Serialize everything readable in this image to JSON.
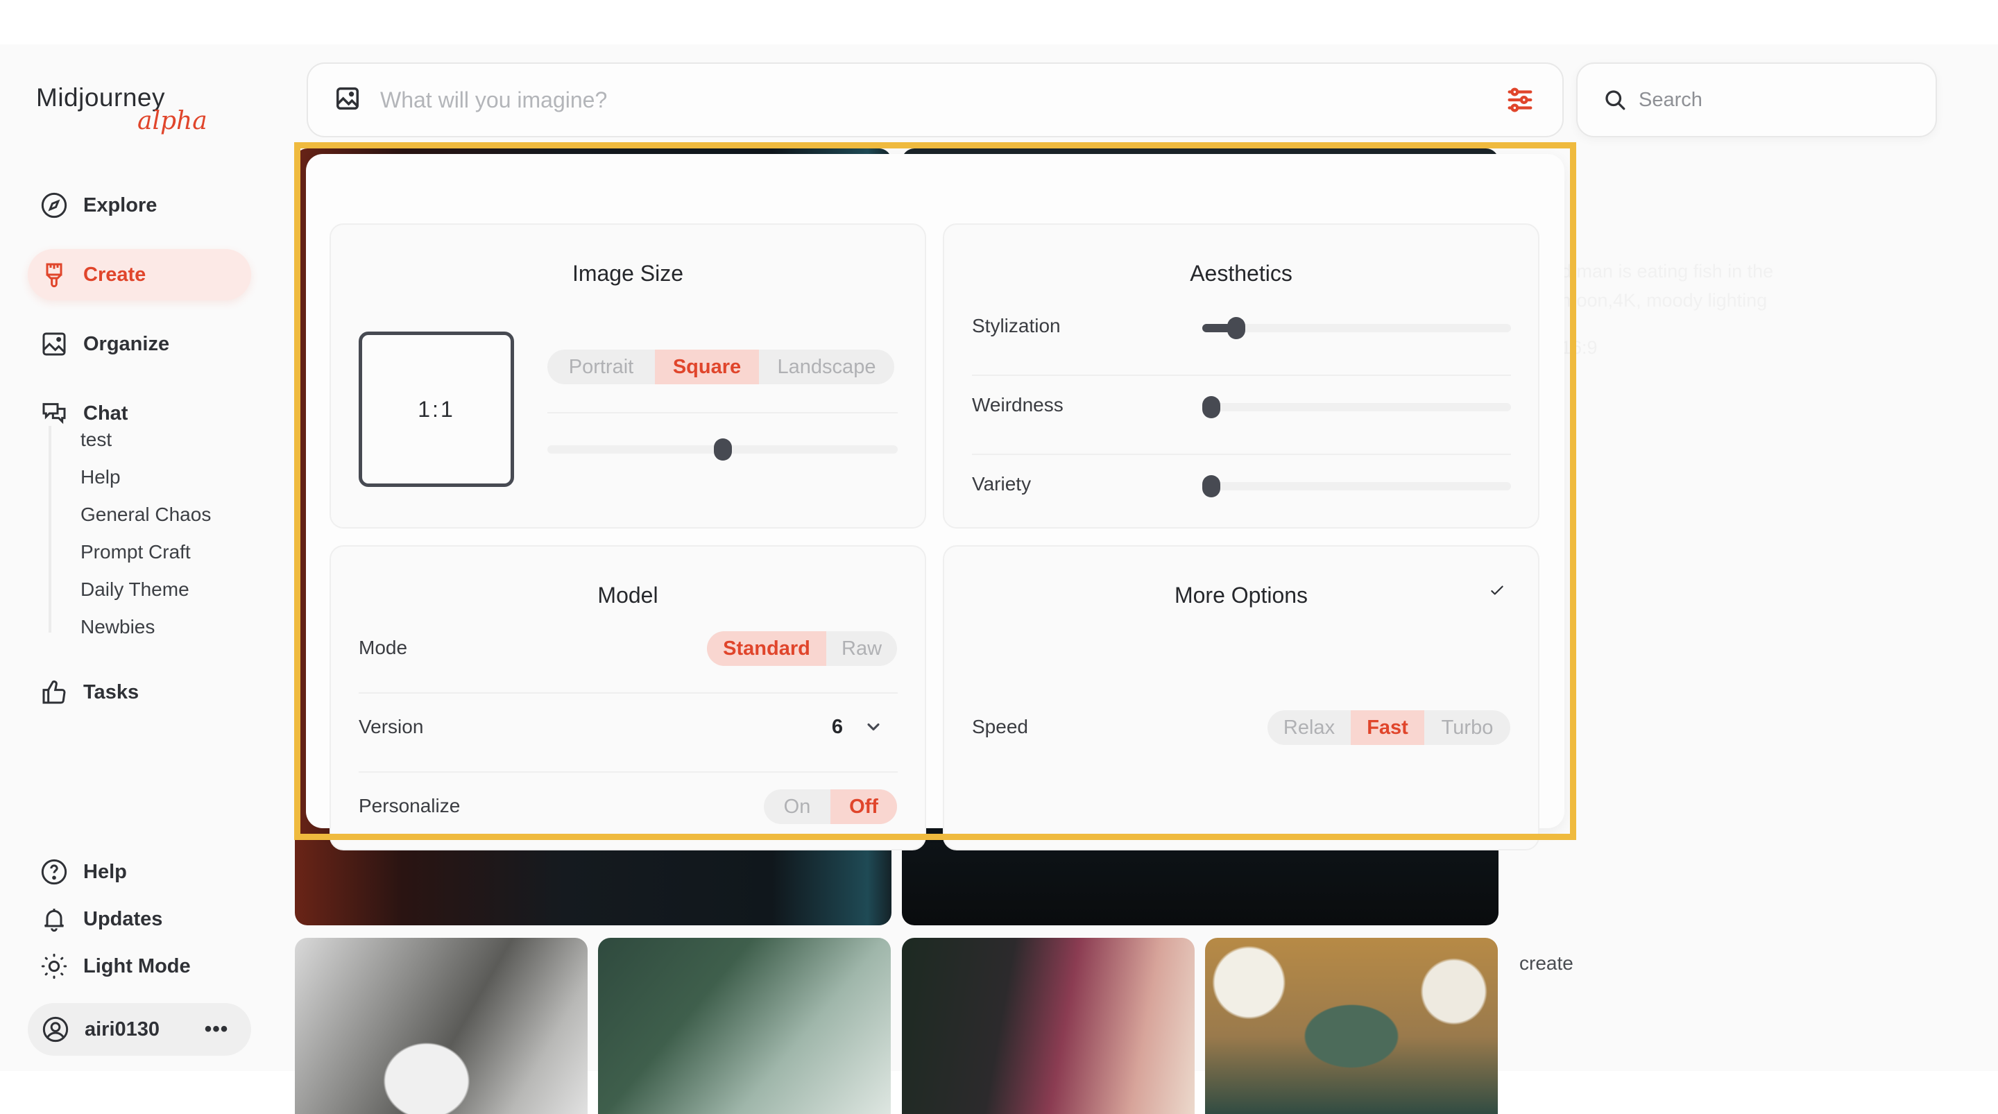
{
  "brand": {
    "name": "Midjourney",
    "tag": "alpha",
    "accent": "#e0452b",
    "highlight": "#efba3e"
  },
  "sidebar": {
    "items": [
      {
        "label": "Explore",
        "icon": "compass-icon"
      },
      {
        "label": "Create",
        "icon": "paintbrush-icon",
        "active": true
      },
      {
        "label": "Organize",
        "icon": "image-icon"
      },
      {
        "label": "Chat",
        "icon": "chat-bubbles-icon"
      }
    ],
    "chat_rooms": [
      "test",
      "Help",
      "General Chaos",
      "Prompt Craft",
      "Daily Theme",
      "Newbies"
    ],
    "tasks": {
      "label": "Tasks",
      "icon": "thumbs-up-icon"
    },
    "bottom": [
      {
        "label": "Help",
        "icon": "question-circle-icon"
      },
      {
        "label": "Updates",
        "icon": "bell-icon"
      },
      {
        "label": "Light Mode",
        "icon": "sun-icon"
      }
    ],
    "user": {
      "name": "airi0130",
      "menu": "•••"
    }
  },
  "prompt": {
    "placeholder": "What will you imagine?",
    "value": ""
  },
  "search": {
    "placeholder": "Search",
    "value": ""
  },
  "settings": {
    "image_size": {
      "title": "Image Size",
      "ratio": "1:1",
      "orientations": [
        "Portrait",
        "Square",
        "Landscape"
      ],
      "selected": "Square",
      "ratio_slider": 0.5
    },
    "aesthetics": {
      "title": "Aesthetics",
      "sliders": [
        {
          "label": "Stylization",
          "value": 0.11
        },
        {
          "label": "Weirdness",
          "value": 0.0
        },
        {
          "label": "Variety",
          "value": 0.0
        }
      ]
    },
    "model": {
      "title": "Model",
      "mode_label": "Mode",
      "modes": [
        "Standard",
        "Raw"
      ],
      "mode_selected": "Standard",
      "version_label": "Version",
      "version_value": "6",
      "personalize_label": "Personalize",
      "personalize_options": [
        "On",
        "Off"
      ],
      "personalize_selected": "Off"
    },
    "more_options": {
      "title": "More Options",
      "speed_label": "Speed",
      "speeds": [
        "Relax",
        "Fast",
        "Turbo"
      ],
      "speed_selected": "Fast"
    }
  },
  "background": {
    "faded_prompt_line1": "d man is eating fish in the",
    "faded_prompt_line2": "moon,4K, moody lighting",
    "faded_ratio": "16:9",
    "create_label": "create"
  }
}
